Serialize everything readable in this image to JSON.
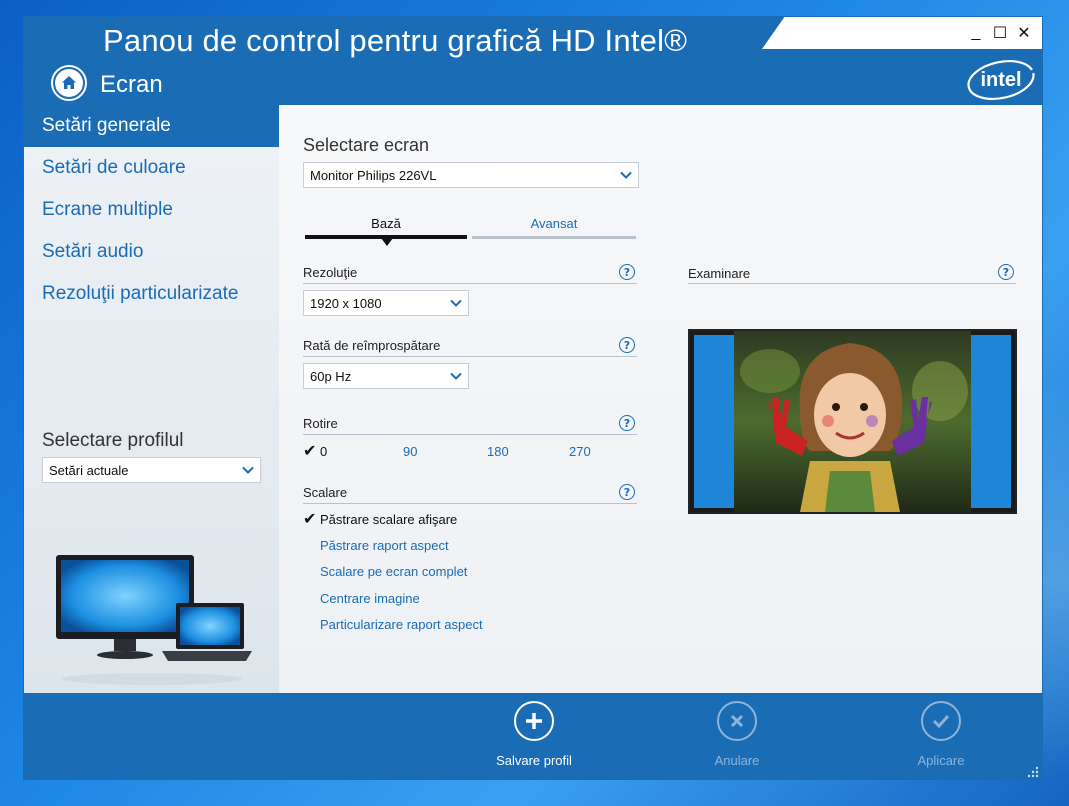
{
  "window": {
    "title": "Panou de control pentru grafică HD Intel®",
    "section": "Ecran",
    "brand": "intel",
    "controls": {
      "minimize": "_",
      "maximize": "☐",
      "close": "✕"
    }
  },
  "sidebar": {
    "items": [
      {
        "label": "Setări generale",
        "active": true
      },
      {
        "label": "Setări de culoare",
        "active": false
      },
      {
        "label": "Ecrane multiple",
        "active": false
      },
      {
        "label": "Setări audio",
        "active": false
      },
      {
        "label": "Rezoluţii particularizate",
        "active": false
      }
    ],
    "profile_label": "Selectare profilul",
    "profile_value": "Setări actuale"
  },
  "main": {
    "display_label": "Selectare ecran",
    "display_value": "Monitor Philips 226VL",
    "tabs": [
      {
        "label": "Bază",
        "active": true
      },
      {
        "label": "Avansat",
        "active": false
      }
    ],
    "resolution": {
      "label": "Rezoluţie",
      "value": "1920 x 1080"
    },
    "refresh": {
      "label": "Rată de reîmprospătare",
      "value": "60p Hz"
    },
    "rotation": {
      "label": "Rotire",
      "options": [
        "0",
        "90",
        "180",
        "270"
      ],
      "selected": "0"
    },
    "scaling": {
      "label": "Scalare",
      "options": [
        "Păstrare scalare afişare",
        "Păstrare raport aspect",
        "Scalare pe ecran complet",
        "Centrare imagine",
        "Particularizare raport aspect"
      ],
      "selected": "Păstrare scalare afişare"
    },
    "preview_label": "Examinare",
    "help_glyph": "?"
  },
  "footer": {
    "save_label": "Salvare profil",
    "cancel_label": "Anulare",
    "apply_label": "Aplicare"
  },
  "colors": {
    "accent": "#1a6cb5",
    "disabled": "#8fb4d8"
  }
}
